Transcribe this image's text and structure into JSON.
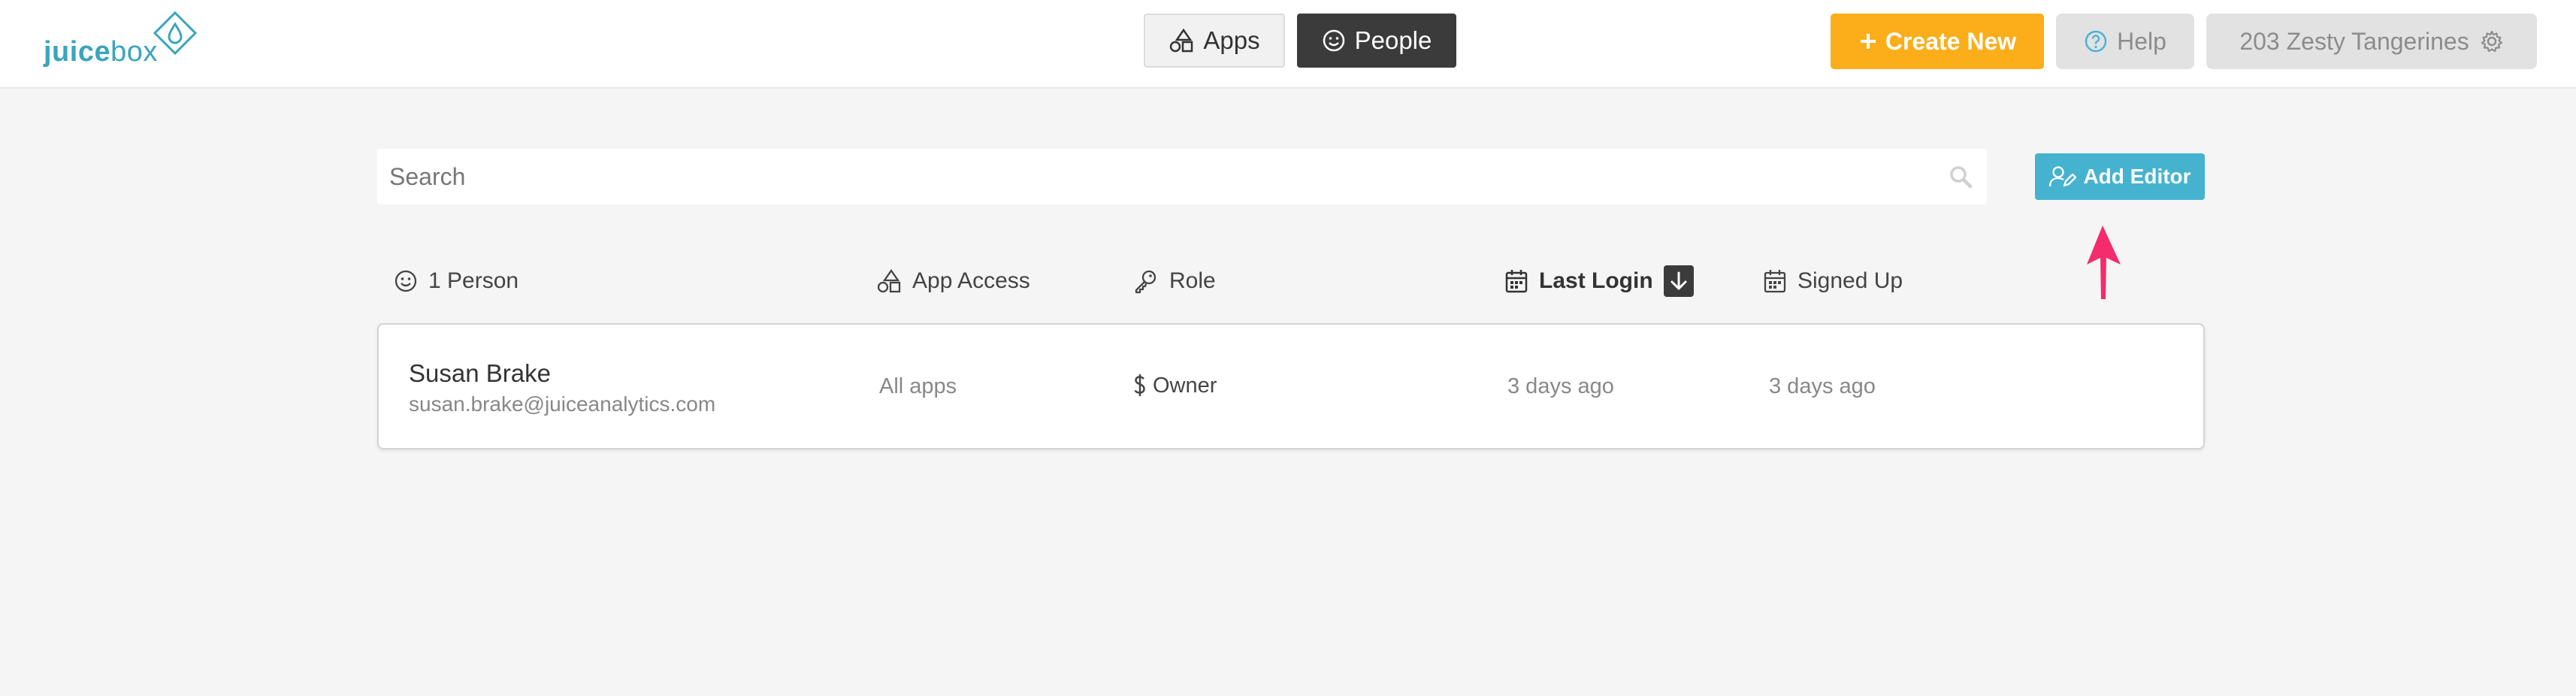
{
  "header": {
    "logo": {
      "part1": "juice",
      "part2": "box"
    },
    "nav": {
      "apps_label": "Apps",
      "people_label": "People"
    },
    "create_label": "Create New",
    "help_label": "Help",
    "account_label": "203 Zesty Tangerines"
  },
  "search": {
    "placeholder": "Search"
  },
  "add_editor_label": "Add Editor",
  "table": {
    "columns": {
      "person": "1 Person",
      "app_access": "App Access",
      "role": "Role",
      "last_login": "Last Login",
      "signed_up": "Signed Up"
    },
    "rows": [
      {
        "name": "Susan Brake",
        "email": "susan.brake@juiceanalytics.com",
        "app_access": "All apps",
        "role": "Owner",
        "last_login": "3 days ago",
        "signed_up": "3 days ago"
      }
    ]
  },
  "colors": {
    "brand": "#3aa5bc",
    "create": "#fbae1a",
    "add_editor": "#45b3cf",
    "annotation_arrow": "#f42b6c",
    "active_nav": "#3b3b3b"
  }
}
